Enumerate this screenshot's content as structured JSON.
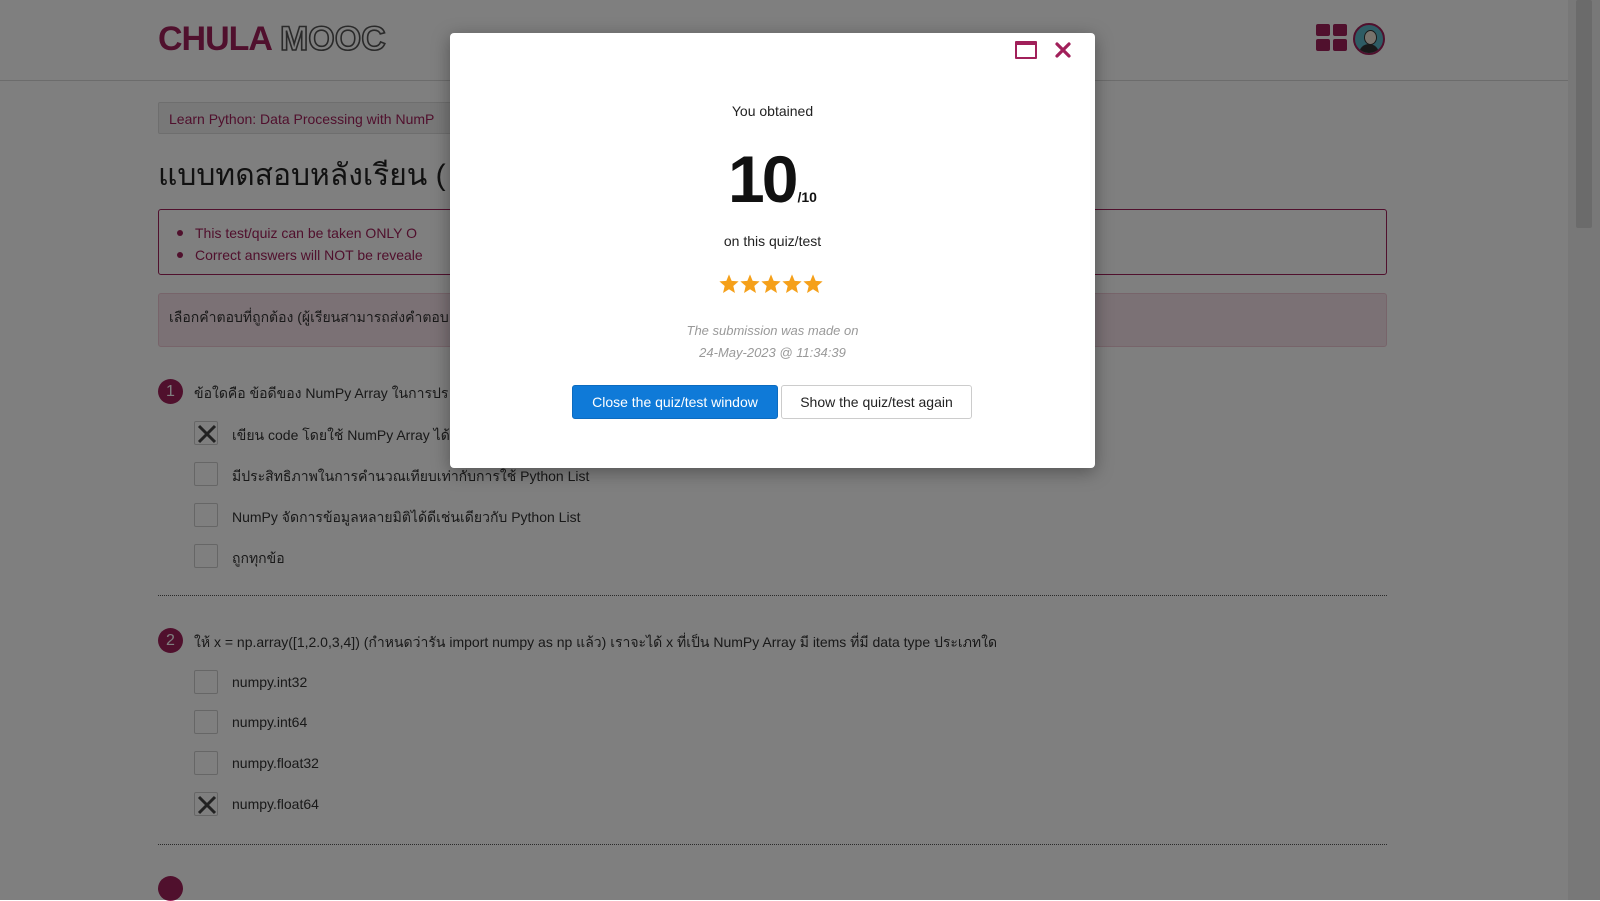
{
  "header": {
    "logo_primary": "CHULA",
    "logo_secondary": "MOOC",
    "apps_icon": "grid-apps-icon",
    "avatar_icon": "user-avatar-icon",
    "brand_color": "#a1205a"
  },
  "breadcrumb": {
    "label": "Learn Python: Data Processing with NumP"
  },
  "page_title": "แบบทดสอบหลังเรียน (",
  "notice": {
    "items": [
      "This test/quiz can be taken ONLY O",
      "Correct answers will NOT be reveale"
    ]
  },
  "instruction": "เลือกคำตอบที่ถูกต้อง (ผู้เรียนสามารถส่งคำตอบ",
  "questions": [
    {
      "number": "1",
      "text": "ข้อใดคือ ข้อดีของ NumPy Array ในการปร",
      "options": [
        {
          "label": "เขียน code โดยใช้ NumPy Array ได้",
          "checked": true
        },
        {
          "label": "มีประสิทธิภาพในการคำนวณเทียบเท่ากับการใช้ Python List",
          "checked": false
        },
        {
          "label": "NumPy จัดการข้อมูลหลายมิติได้ดีเช่นเดียวกับ Python List",
          "checked": false
        },
        {
          "label": "ถูกทุกข้อ",
          "checked": false
        }
      ]
    },
    {
      "number": "2",
      "text": "ให้ x = np.array([1,2.0,3,4]) (กำหนดว่ารัน import numpy as np แล้ว) เราจะได้ x ที่เป็น NumPy Array มี items ที่มี data type ประเภทใด",
      "options": [
        {
          "label": "numpy.int32",
          "checked": false
        },
        {
          "label": "numpy.int64",
          "checked": false
        },
        {
          "label": "numpy.float32",
          "checked": false
        },
        {
          "label": "numpy.float64",
          "checked": true
        }
      ]
    }
  ],
  "modal": {
    "maximize_icon": "maximize-window-icon",
    "close_icon": "close-icon",
    "obtained_label": "You obtained",
    "score": "10",
    "score_total": "/10",
    "on_label": "on this quiz/test",
    "rating": {
      "value": 5,
      "max": 5,
      "icon": "star-icon",
      "color": "#f5a01a"
    },
    "submission_line1": "The submission was made on",
    "submission_line2": "24-May-2023 @ 11:34:39",
    "close_button": "Close the quiz/test window",
    "again_button": "Show the quiz/test again",
    "primary_color": "#0f7ad8"
  }
}
